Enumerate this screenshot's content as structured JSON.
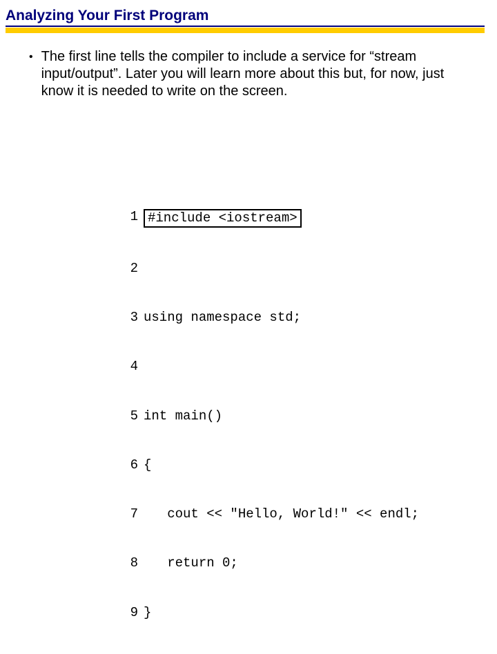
{
  "title": "Analyzing Your First Program",
  "bullet": "The first line tells the compiler to include a service for “stream input/output”. Later you will learn more about this but, for now, just know it is needed to write on the screen.",
  "code": {
    "lines": [
      {
        "n": "1",
        "text": "#include <iostream>",
        "boxed": true
      },
      {
        "n": "2",
        "text": "",
        "boxed": false
      },
      {
        "n": "3",
        "text": "using namespace std;",
        "boxed": false
      },
      {
        "n": "4",
        "text": "",
        "boxed": false
      },
      {
        "n": "5",
        "text": "int main()",
        "boxed": false
      },
      {
        "n": "6",
        "text": "{",
        "boxed": false
      },
      {
        "n": "7",
        "text": "   cout << \"Hello, World!\" << endl;",
        "boxed": false
      },
      {
        "n": "8",
        "text": "   return 0;",
        "boxed": false
      },
      {
        "n": "9",
        "text": "}",
        "boxed": false
      }
    ]
  }
}
